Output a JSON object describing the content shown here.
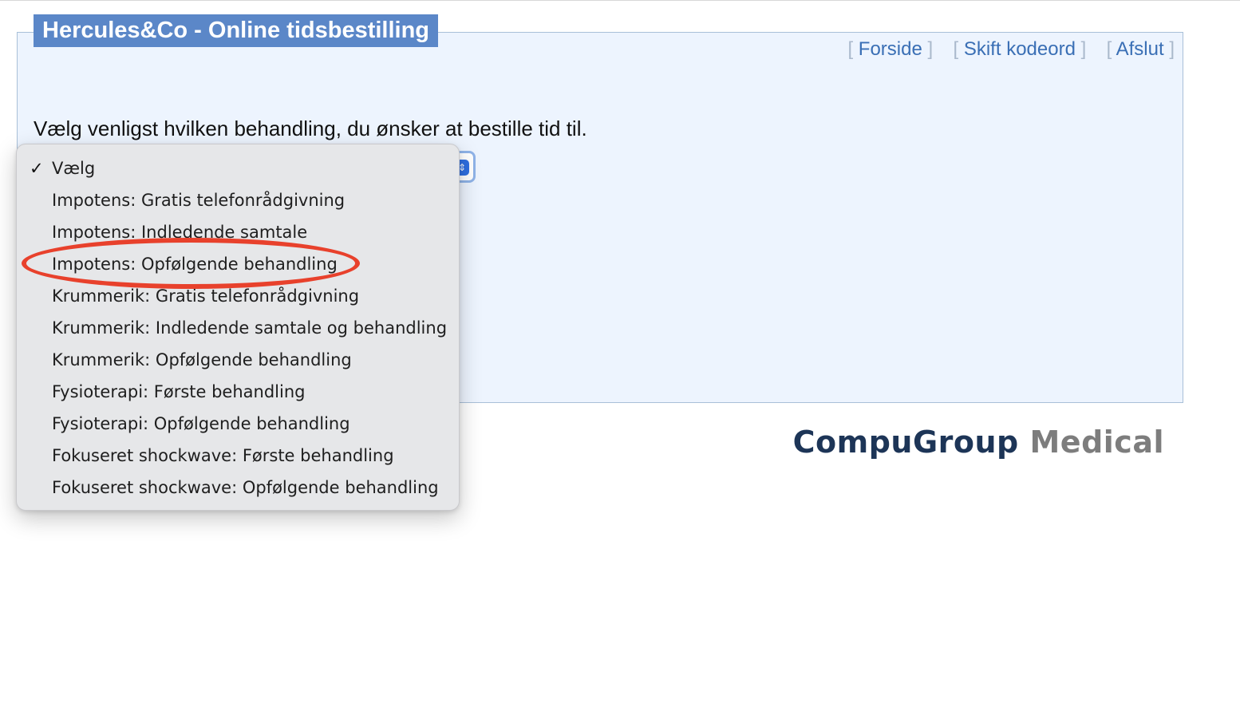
{
  "header": {
    "title": "Hercules&Co - Online tidsbestilling"
  },
  "nav": {
    "links": [
      "Forside",
      "Skift kodeord",
      "Afslut"
    ]
  },
  "main": {
    "prompt": "Vælg venligst hvilken behandling, du ønsker at bestille tid til."
  },
  "dropdown": {
    "selected": "Vælg",
    "options": [
      "Vælg",
      "Impotens: Gratis telefonrådgivning",
      "Impotens: Indledende samtale",
      "Impotens: Opfølgende behandling",
      "Krummerik: Gratis telefonrådgivning",
      "Krummerik: Indledende samtale og behandling",
      "Krummerik: Opfølgende behandling",
      "Fysioterapi: Første behandling",
      "Fysioterapi: Opfølgende behandling",
      "Fokuseret shockwave: Første behandling",
      "Fokuseret shockwave: Opfølgende behandling"
    ],
    "checkmark": "✓",
    "annotated_option": "Impotens: Opfølgende behandling"
  },
  "footer": {
    "logo_primary": "CompuGroup",
    "logo_secondary": "Medical"
  },
  "colors": {
    "title_bg": "#5b87c8",
    "panel_bg": "#edf4fe",
    "link": "#3a6fb5",
    "annotation_ring": "#e8412c",
    "logo_dark": "#1d3557",
    "logo_gray": "#7d7d7d"
  }
}
